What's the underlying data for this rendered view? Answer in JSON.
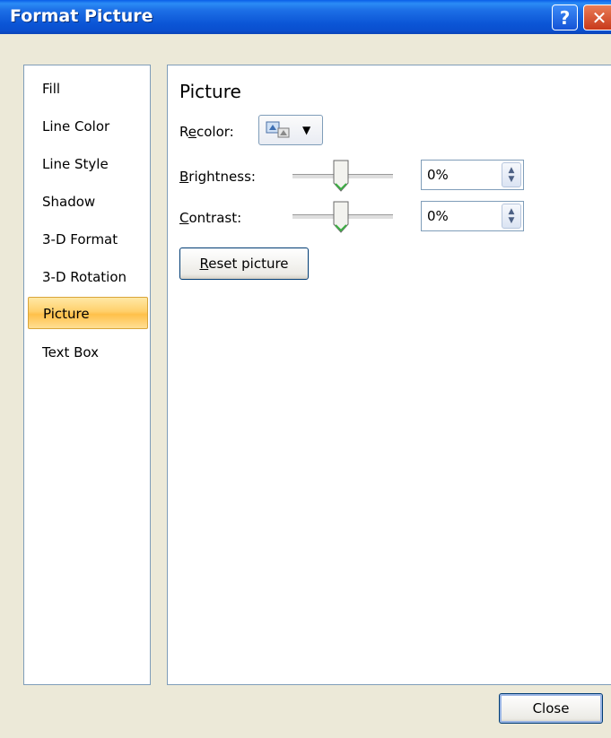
{
  "window": {
    "title": "Format Picture",
    "help_glyph": "?",
    "close_glyph": "✕"
  },
  "nav": {
    "items": [
      {
        "label": "Fill",
        "selected": false
      },
      {
        "label": "Line Color",
        "selected": false
      },
      {
        "label": "Line Style",
        "selected": false
      },
      {
        "label": "Shadow",
        "selected": false
      },
      {
        "label": "3-D Format",
        "selected": false
      },
      {
        "label": "3-D Rotation",
        "selected": false
      },
      {
        "label": "Picture",
        "selected": true
      },
      {
        "label": "Text Box",
        "selected": false
      }
    ]
  },
  "picture": {
    "section_title": "Picture",
    "recolor": {
      "label_pre": "R",
      "label_mnemonic": "e",
      "label_post": "color:",
      "arrow": "▼"
    },
    "brightness": {
      "label_mnemonic": "B",
      "label_post": "rightness:",
      "value": "0%",
      "level_percent": 0
    },
    "contrast": {
      "label_mnemonic": "C",
      "label_post": "ontrast:",
      "value": "0%",
      "level_percent": 0
    },
    "reset": {
      "label_mnemonic": "R",
      "label_post": "eset picture"
    },
    "spin_up": "▲",
    "spin_down": "▼"
  },
  "footer": {
    "close_label": "Close"
  },
  "colors": {
    "title_bar": "#0a5ee8",
    "dialog_bg": "#ece9d8",
    "selected_item": "#ffc04a"
  }
}
